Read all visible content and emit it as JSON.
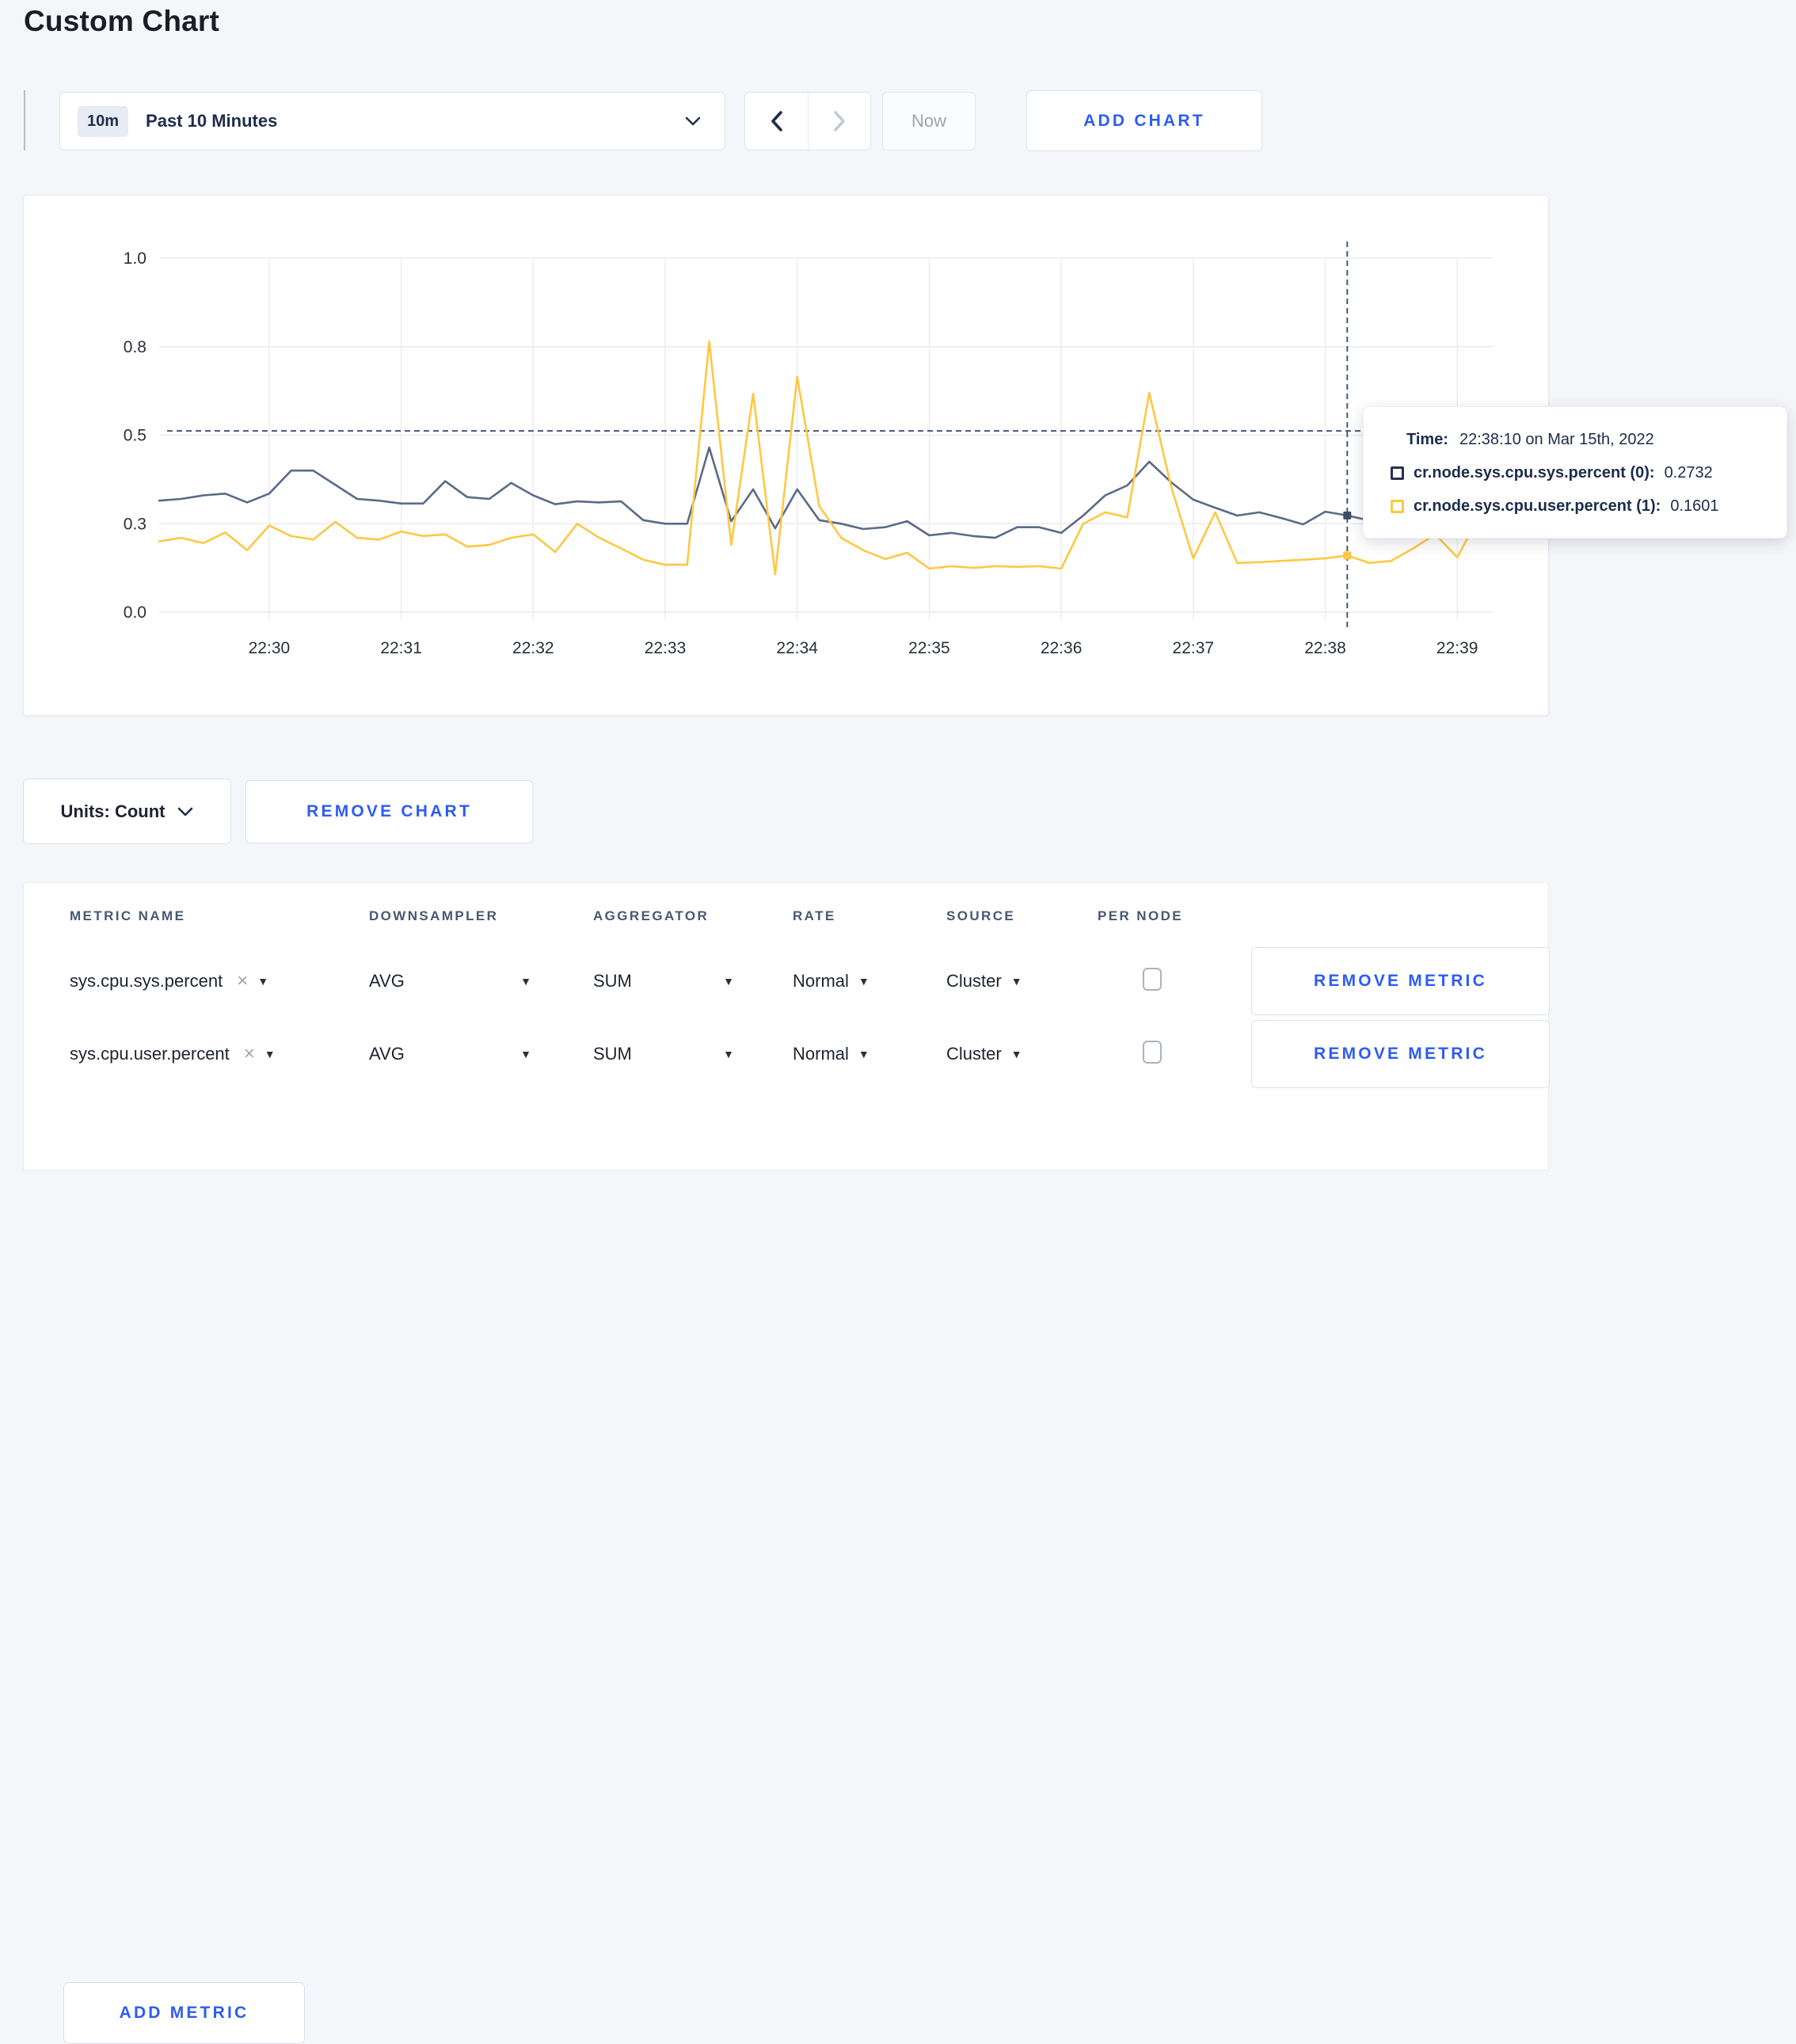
{
  "page": {
    "title": "Custom Chart"
  },
  "toolbar": {
    "time_badge": "10m",
    "time_label": "Past 10 Minutes",
    "now_label": "Now",
    "add_chart_label": "ADD CHART"
  },
  "chart_controls": {
    "units_label": "Units: Count",
    "remove_chart_label": "REMOVE CHART"
  },
  "tooltip": {
    "time_label": "Time:",
    "time_value": "22:38:10 on Mar 15th, 2022",
    "rows": [
      {
        "label": "cr.node.sys.cpu.sys.percent (0):",
        "value": "0.2732",
        "color": "#233450"
      },
      {
        "label": "cr.node.sys.cpu.user.percent (1):",
        "value": "0.1601",
        "color": "#ffc844"
      }
    ]
  },
  "chart_data": {
    "type": "line",
    "title": "",
    "xlabel": "",
    "ylabel": "",
    "x_start_time": "22:29:10",
    "x_domain_seconds": [
      0,
      600
    ],
    "t_step_seconds": 10,
    "x_ticks": [
      {
        "t": 50,
        "label": "22:30"
      },
      {
        "t": 110,
        "label": "22:31"
      },
      {
        "t": 170,
        "label": "22:32"
      },
      {
        "t": 230,
        "label": "22:33"
      },
      {
        "t": 290,
        "label": "22:34"
      },
      {
        "t": 350,
        "label": "22:35"
      },
      {
        "t": 410,
        "label": "22:36"
      },
      {
        "t": 470,
        "label": "22:37"
      },
      {
        "t": 530,
        "label": "22:38"
      },
      {
        "t": 590,
        "label": "22:39"
      }
    ],
    "y_ticks": [
      {
        "value": 0.0,
        "label": "0.0"
      },
      {
        "value": 0.25,
        "label": "0.3"
      },
      {
        "value": 0.5,
        "label": "0.5"
      },
      {
        "value": 0.75,
        "label": "0.8"
      },
      {
        "value": 1.0,
        "label": "1.0"
      }
    ],
    "ylim": [
      0,
      1
    ],
    "grid": true,
    "legend_position": "none",
    "crosshair": {
      "t": 540,
      "time": "22:38:10",
      "hline_value": 0.512,
      "color": "#47587a"
    },
    "series": [
      {
        "name": "cr.node.sys.cpu.sys.percent",
        "color": "#5a6b87",
        "marker_color": "#3c4c68",
        "hover_value": 0.2732,
        "values": [
          0.315,
          0.32,
          0.33,
          0.335,
          0.31,
          0.335,
          0.4,
          0.4,
          0.36,
          0.32,
          0.315,
          0.307,
          0.307,
          0.37,
          0.325,
          0.32,
          0.365,
          0.33,
          0.305,
          0.313,
          0.31,
          0.313,
          0.26,
          0.25,
          0.25,
          0.465,
          0.257,
          0.347,
          0.237,
          0.347,
          0.26,
          0.25,
          0.235,
          0.24,
          0.257,
          0.217,
          0.224,
          0.215,
          0.21,
          0.24,
          0.24,
          0.224,
          0.273,
          0.33,
          0.358,
          0.425,
          0.367,
          0.318,
          0.295,
          0.273,
          0.282,
          0.266,
          0.248,
          0.284,
          0.2732,
          0.259,
          0.27,
          0.275,
          0.27,
          0.275,
          0.27
        ]
      },
      {
        "name": "cr.node.sys.cpu.user.percent",
        "color": "#ffc844",
        "marker_color": "#ffc844",
        "hover_value": 0.1601,
        "values": [
          0.2,
          0.21,
          0.195,
          0.225,
          0.175,
          0.245,
          0.215,
          0.205,
          0.255,
          0.21,
          0.205,
          0.228,
          0.215,
          0.22,
          0.185,
          0.19,
          0.21,
          0.22,
          0.17,
          0.25,
          0.21,
          0.18,
          0.148,
          0.134,
          0.134,
          0.765,
          0.19,
          0.617,
          0.107,
          0.665,
          0.3,
          0.21,
          0.175,
          0.15,
          0.168,
          0.123,
          0.13,
          0.125,
          0.13,
          0.128,
          0.13,
          0.123,
          0.25,
          0.282,
          0.268,
          0.62,
          0.354,
          0.152,
          0.282,
          0.139,
          0.141,
          0.145,
          0.148,
          0.152,
          0.1601,
          0.139,
          0.145,
          0.18,
          0.22,
          0.155,
          0.27
        ]
      }
    ]
  },
  "metrics_table": {
    "headers": [
      "METRIC NAME",
      "DOWNSAMPLER",
      "AGGREGATOR",
      "RATE",
      "SOURCE",
      "PER NODE"
    ],
    "rows": [
      {
        "metric": "sys.cpu.sys.percent",
        "downsampler": "AVG",
        "aggregator": "SUM",
        "rate": "Normal",
        "source": "Cluster",
        "per_node_checked": false,
        "remove_label": "REMOVE METRIC"
      },
      {
        "metric": "sys.cpu.user.percent",
        "downsampler": "AVG",
        "aggregator": "SUM",
        "rate": "Normal",
        "source": "Cluster",
        "per_node_checked": false,
        "remove_label": "REMOVE METRIC"
      }
    ],
    "add_metric_label": "ADD METRIC"
  }
}
